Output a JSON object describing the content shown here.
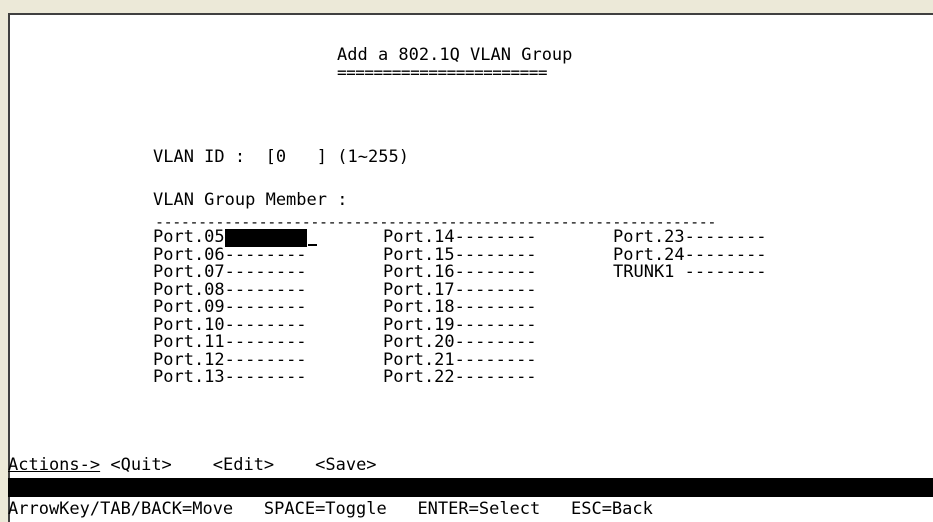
{
  "screen": {
    "title": "Add a 802.1Q VLAN Group",
    "title_underline": "======================="
  },
  "vlan": {
    "id_label": "VLAN ID :",
    "id_value": "[0   ]",
    "id_range": "(1~255)",
    "member_label": "VLAN Group Member :",
    "divider": "-----------------------------------------------------------------"
  },
  "ports": {
    "col1": [
      {
        "name": "Port.05",
        "value": "--------",
        "selected": true
      },
      {
        "name": "Port.06",
        "value": "--------"
      },
      {
        "name": "Port.07",
        "value": "--------"
      },
      {
        "name": "Port.08",
        "value": "--------"
      },
      {
        "name": "Port.09",
        "value": "--------"
      },
      {
        "name": "Port.10",
        "value": "--------"
      },
      {
        "name": "Port.11",
        "value": "--------"
      },
      {
        "name": "Port.12",
        "value": "--------"
      },
      {
        "name": "Port.13",
        "value": "--------"
      }
    ],
    "col2": [
      {
        "name": "Port.14",
        "value": "--------"
      },
      {
        "name": "Port.15",
        "value": "--------"
      },
      {
        "name": "Port.16",
        "value": "--------"
      },
      {
        "name": "Port.17",
        "value": "--------"
      },
      {
        "name": "Port.18",
        "value": "--------"
      },
      {
        "name": "Port.19",
        "value": "--------"
      },
      {
        "name": "Port.20",
        "value": "--------"
      },
      {
        "name": "Port.21",
        "value": "--------"
      },
      {
        "name": "Port.22",
        "value": "--------"
      }
    ],
    "col3": [
      {
        "name": "Port.23",
        "value": "--------"
      },
      {
        "name": "Port.24",
        "value": "--------"
      },
      {
        "name": "TRUNK1 ",
        "value": "--------"
      }
    ]
  },
  "actions": {
    "label": "Actions->",
    "quit": "<Quit>",
    "edit": "<Edit>",
    "save": "<Save>"
  },
  "help": {
    "move": "ArrowKey/TAB/BACK=Move",
    "toggle": "SPACE=Toggle",
    "select": "ENTER=Select",
    "back": "ESC=Back"
  }
}
